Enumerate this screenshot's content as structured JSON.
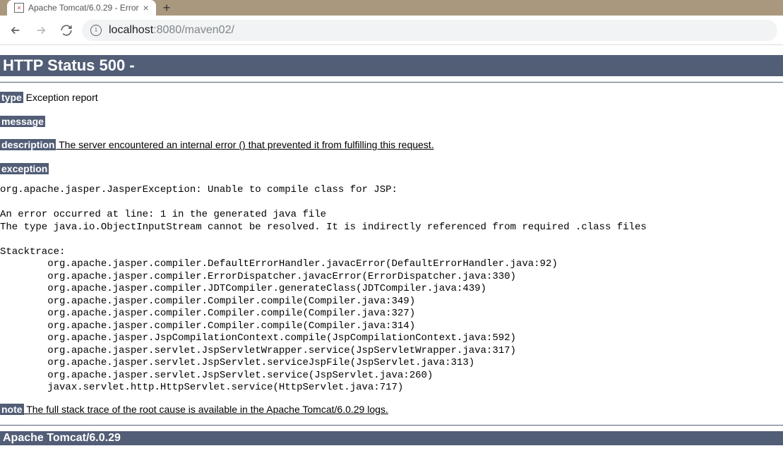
{
  "browser": {
    "tab_title": "Apache Tomcat/6.0.29 - Error",
    "url_host": "localhost",
    "url_port_path": ":8080/maven02/"
  },
  "page": {
    "status_banner": "HTTP Status 500 -",
    "type_label": "type",
    "type_value": " Exception report",
    "message_label": "message",
    "description_label": "description",
    "description_value": " The server encountered an internal error () that prevented it from fulfilling this request.",
    "exception_label": "exception",
    "stacktrace": "org.apache.jasper.JasperException: Unable to compile class for JSP: \n\nAn error occurred at line: 1 in the generated java file\nThe type java.io.ObjectInputStream cannot be resolved. It is indirectly referenced from required .class files\n\nStacktrace:\n\torg.apache.jasper.compiler.DefaultErrorHandler.javacError(DefaultErrorHandler.java:92)\n\torg.apache.jasper.compiler.ErrorDispatcher.javacError(ErrorDispatcher.java:330)\n\torg.apache.jasper.compiler.JDTCompiler.generateClass(JDTCompiler.java:439)\n\torg.apache.jasper.compiler.Compiler.compile(Compiler.java:349)\n\torg.apache.jasper.compiler.Compiler.compile(Compiler.java:327)\n\torg.apache.jasper.compiler.Compiler.compile(Compiler.java:314)\n\torg.apache.jasper.JspCompilationContext.compile(JspCompilationContext.java:592)\n\torg.apache.jasper.servlet.JspServletWrapper.service(JspServletWrapper.java:317)\n\torg.apache.jasper.servlet.JspServlet.serviceJspFile(JspServlet.java:313)\n\torg.apache.jasper.servlet.JspServlet.service(JspServlet.java:260)\n\tjavax.servlet.http.HttpServlet.service(HttpServlet.java:717)\n",
    "note_label": "note",
    "note_value": " The full stack trace of the root cause is available in the Apache Tomcat/6.0.29 logs.",
    "footer": "Apache Tomcat/6.0.29"
  }
}
